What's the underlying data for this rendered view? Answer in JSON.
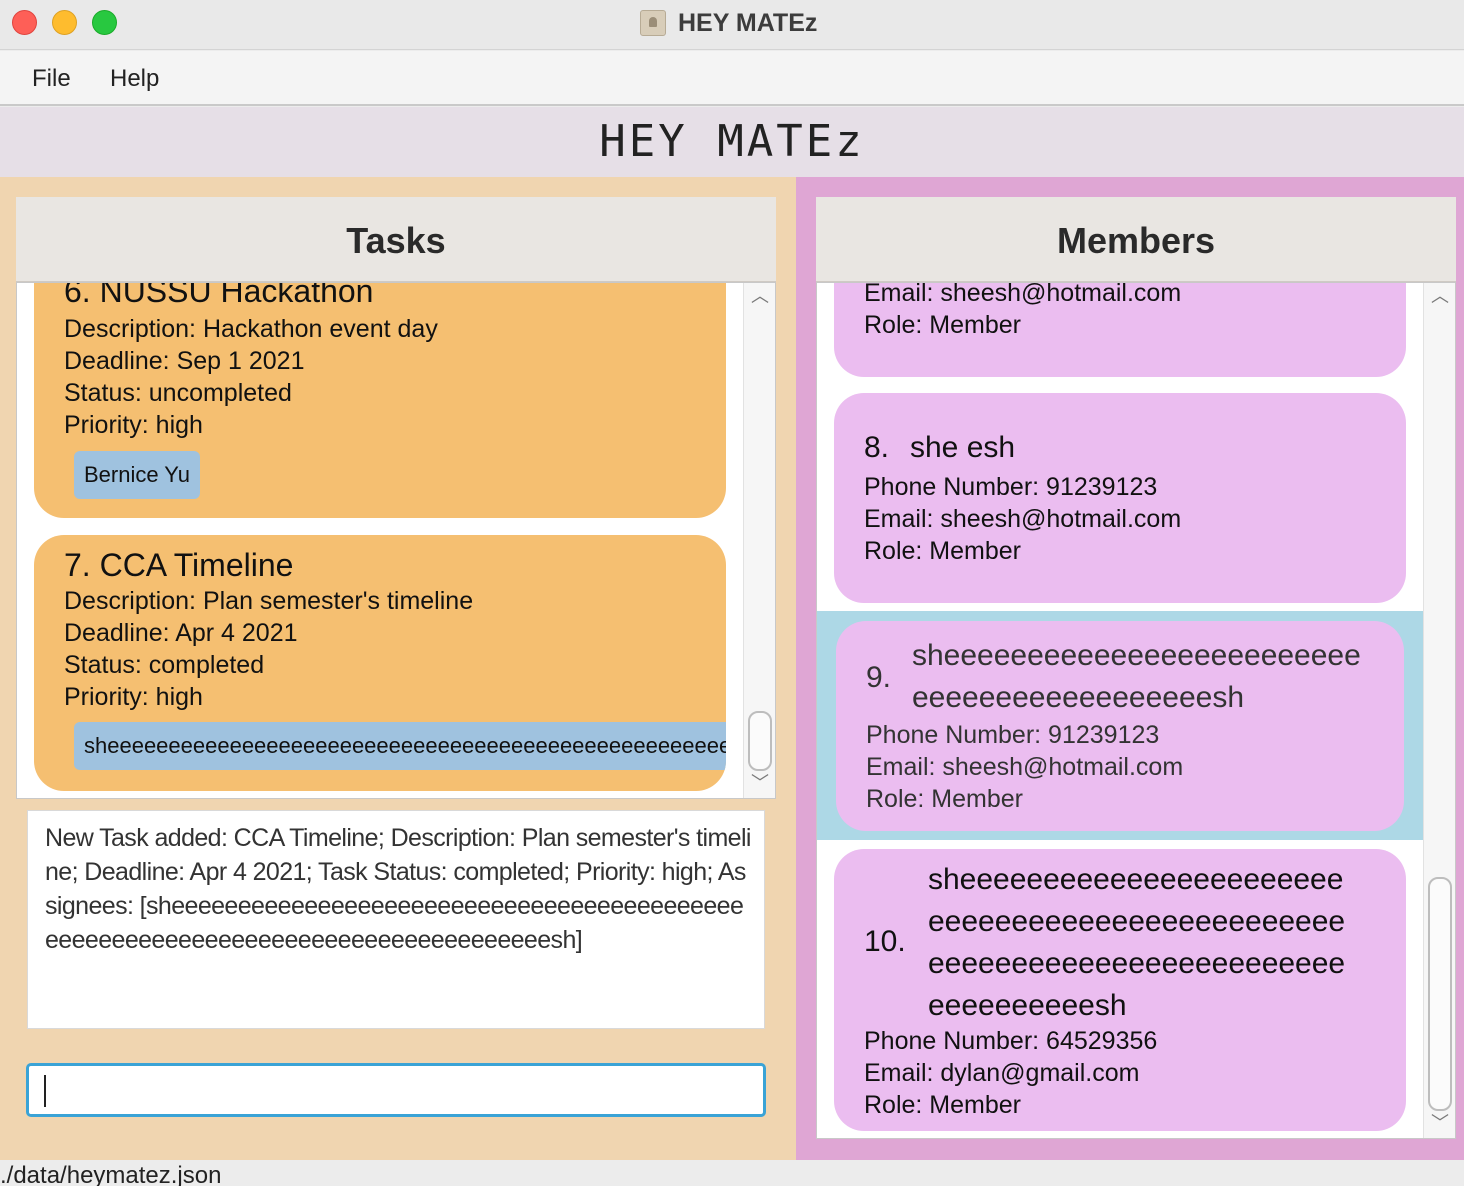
{
  "window": {
    "title": "HEY MATEz"
  },
  "menu": {
    "items": [
      "File",
      "Help"
    ]
  },
  "app_header": "HEY MATEz",
  "tasks_panel": {
    "title": "Tasks",
    "items": [
      {
        "title": "6.  NUSSU Hackathon",
        "description": "Description: Hackathon event day",
        "deadline": "Deadline: Sep 1 2021",
        "status": "Status: uncompleted",
        "priority": "Priority: high",
        "assignee": "Bernice Yu"
      },
      {
        "title": "7.  CCA Timeline",
        "description": "Description: Plan semester's timeline",
        "deadline": "Deadline: Apr 4 2021",
        "status": "Status: completed",
        "priority": "Priority: high",
        "assignee": "sheeeeeeeeeeeeeeeeeeeeeeeeeeeeeeeeeeeeeeeeeeeeeeeeeeeeeeeeeeeeeeeeeeeeeeeeeeeesh"
      }
    ]
  },
  "result_display": "New Task added: CCA Timeline; Description: Plan semester's timeline; Deadline: Apr 4 2021; Task Status: completed; Priority: high; Assignees: [sheeeeeeeeeeeeeeeeeeeeeeeeeeeeeeeeeeeeeeeeeeeeeeeeeeeeeeeeeeeeeeeeeeeeeeeeeeeeeeeeesh]",
  "command_box": {
    "value": ""
  },
  "members_panel": {
    "title": "Members",
    "items": [
      {
        "email": "Email: sheesh@hotmail.com",
        "role": "Role: Member"
      },
      {
        "index": "8.",
        "name": "she esh",
        "phone": "Phone Number: 91239123",
        "email": "Email: sheesh@hotmail.com",
        "role": "Role: Member"
      },
      {
        "index": "9.",
        "name_line1": "sheeeeeeeeeeeeeeeeeeeeeeeee",
        "name_line2": "eeeeeeeeeeeeeeeeeesh",
        "phone": "Phone Number: 91239123",
        "email": "Email: sheesh@hotmail.com",
        "role": "Role: Member"
      },
      {
        "index": "10.",
        "name_line1": "sheeeeeeeeeeeeeeeeeeeeeee",
        "name_line2": "eeeeeeeeeeeeeeeeeeeeeeeee",
        "name_line3": "eeeeeeeeeeeeeeeeeeeeeeeee",
        "name_line4": "eeeeeeeeeesh",
        "phone": "Phone Number: 64529356",
        "email": "Email: dylan@gmail.com",
        "role": "Role: Member"
      }
    ]
  },
  "status_bar": "./data/heymatez.json",
  "colors": {
    "tasks_background": "#f0d5b0",
    "task_card": "#f5bf71",
    "members_background": "#dfa6d4",
    "member_card": "#ebbdf0",
    "selected_row": "#add8e6",
    "tag": "#9fc2df",
    "input_focus": "#3aa3d6"
  }
}
